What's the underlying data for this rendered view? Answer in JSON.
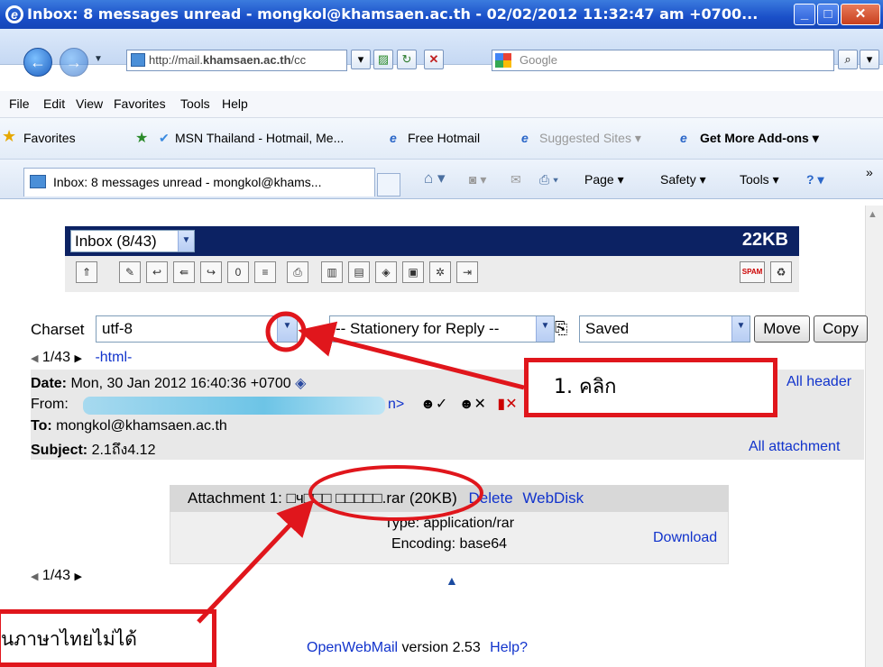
{
  "window": {
    "title": "Inbox: 8 messages unread - mongkol@khamsaen.ac.th - 02/02/2012 11:32:47 am +0700..."
  },
  "nav": {
    "address_prefix": "http://mail.",
    "address_domain": "khamsaen.ac.th",
    "address_suffix": "/cc",
    "search_placeholder": "Google"
  },
  "menu": [
    "File",
    "Edit",
    "View",
    "Favorites",
    "Tools",
    "Help"
  ],
  "favorites": {
    "label": "Favorites",
    "items": [
      "MSN Thailand - Hotmail, Me...",
      "Free Hotmail",
      "Suggested Sites ▾",
      "Get More Add-ons ▾"
    ]
  },
  "tab": {
    "label": "Inbox: 8 messages unread - mongkol@khams...",
    "commands": [
      "Page ▾",
      "Safety ▾",
      "Tools ▾"
    ]
  },
  "mail": {
    "folder": "Inbox (8/43)",
    "size": "22KB",
    "charset_label": "Charset",
    "charset_value": "utf-8",
    "stationery": "-- Stationery for Reply --",
    "dest_folder": "Saved",
    "move_label": "Move",
    "copy_label": "Copy",
    "pager": "1/43",
    "html_link": "-html-",
    "date_label": "Date:",
    "date_value": "Mon, 30 Jan 2012 16:40:36 +0700",
    "from_label": "From:",
    "from_suffix": "n>",
    "to_label": "To:",
    "to_value": "mongkol@khamsaen.ac.th",
    "subject_label": "Subject:",
    "subject_value": "2.1ถึง4.12",
    "all_headers": "All header",
    "all_attachments": "All attachment",
    "attachment_label": "Attachment 1:",
    "attachment_name": "□ч□□□ □□□□□.rar",
    "attachment_size": "(20KB)",
    "delete_label": "Delete",
    "webdisk_label": "WebDisk",
    "type_line": "Type: application/rar",
    "encoding_line": "Encoding: base64",
    "download_label": "Download",
    "footer_app": "OpenWebMail",
    "footer_version": "version 2.53",
    "footer_help": "Help?"
  },
  "annotations": {
    "callout1": "1. คลิก",
    "callout2": "นภาษาไทยไม่ได้",
    "color": "#e0161c"
  }
}
